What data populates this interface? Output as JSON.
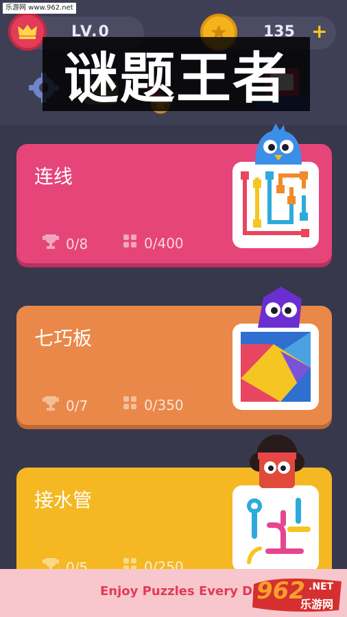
{
  "watermark": "乐游网 www.962.net",
  "header": {
    "level": "LV.0",
    "coins": "135",
    "add_coins": "+"
  },
  "title_overlay": "谜题王者",
  "games": [
    {
      "name": "连线",
      "trophies": "0/8",
      "levels": "0/400",
      "color": "#e6457a"
    },
    {
      "name": "七巧板",
      "trophies": "0/7",
      "levels": "0/350",
      "color": "#ea8849"
    },
    {
      "name": "接水管",
      "trophies": "0/5",
      "levels": "0/250",
      "color": "#f5b823"
    }
  ],
  "footer": {
    "tagline": "Enjoy Puzzles Every Day!",
    "brand_number": "962",
    "brand_suffix": ".NET",
    "brand_cn": "乐游网"
  },
  "icons": [
    "crown-icon",
    "star-coin-icon",
    "plus-icon",
    "gear-icon",
    "message-icon",
    "medal-icon",
    "shop-icon",
    "trophy-icon",
    "levels-grid-icon"
  ]
}
